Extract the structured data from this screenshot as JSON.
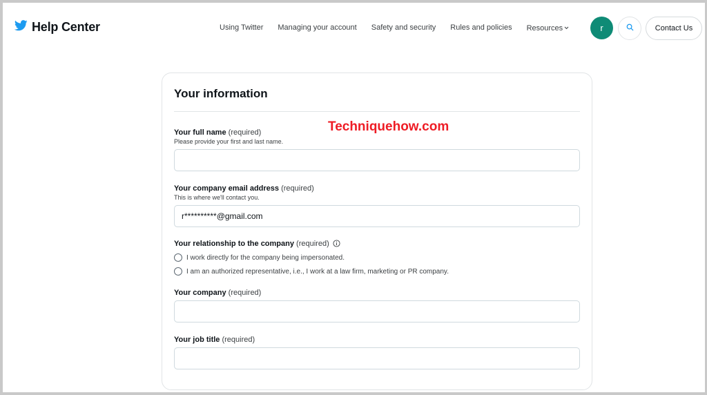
{
  "header": {
    "brand_title": "Help Center",
    "nav": [
      {
        "label": "Using Twitter"
      },
      {
        "label": "Managing your account"
      },
      {
        "label": "Safety and security"
      },
      {
        "label": "Rules and policies"
      },
      {
        "label": "Resources"
      }
    ],
    "avatar_initial": "r",
    "contact_label": "Contact Us"
  },
  "form": {
    "title": "Your information",
    "watermark": "Techniquehow.com",
    "full_name": {
      "label": "Your full name",
      "required": "(required)",
      "hint": "Please provide your first and last name.",
      "value": ""
    },
    "email": {
      "label": "Your company email address",
      "required": "(required)",
      "hint": "This is where we'll contact you.",
      "value": "r**********@gmail.com"
    },
    "relationship": {
      "label": "Your relationship to the company",
      "required": "(required)",
      "options": [
        "I work directly for the company being impersonated.",
        "I am an authorized representative, i.e., I work at a law firm, marketing or PR company."
      ]
    },
    "company": {
      "label": "Your company",
      "required": "(required)",
      "value": ""
    },
    "job_title": {
      "label": "Your job title",
      "required": "(required)",
      "value": ""
    }
  },
  "colors": {
    "brand_blue": "#1d9bf0",
    "avatar_green": "#0f8b76",
    "watermark_red": "#ee1c25"
  },
  "icons": [
    "twitter-bird-icon",
    "chevron-down-icon",
    "search-icon",
    "info-icon"
  ]
}
